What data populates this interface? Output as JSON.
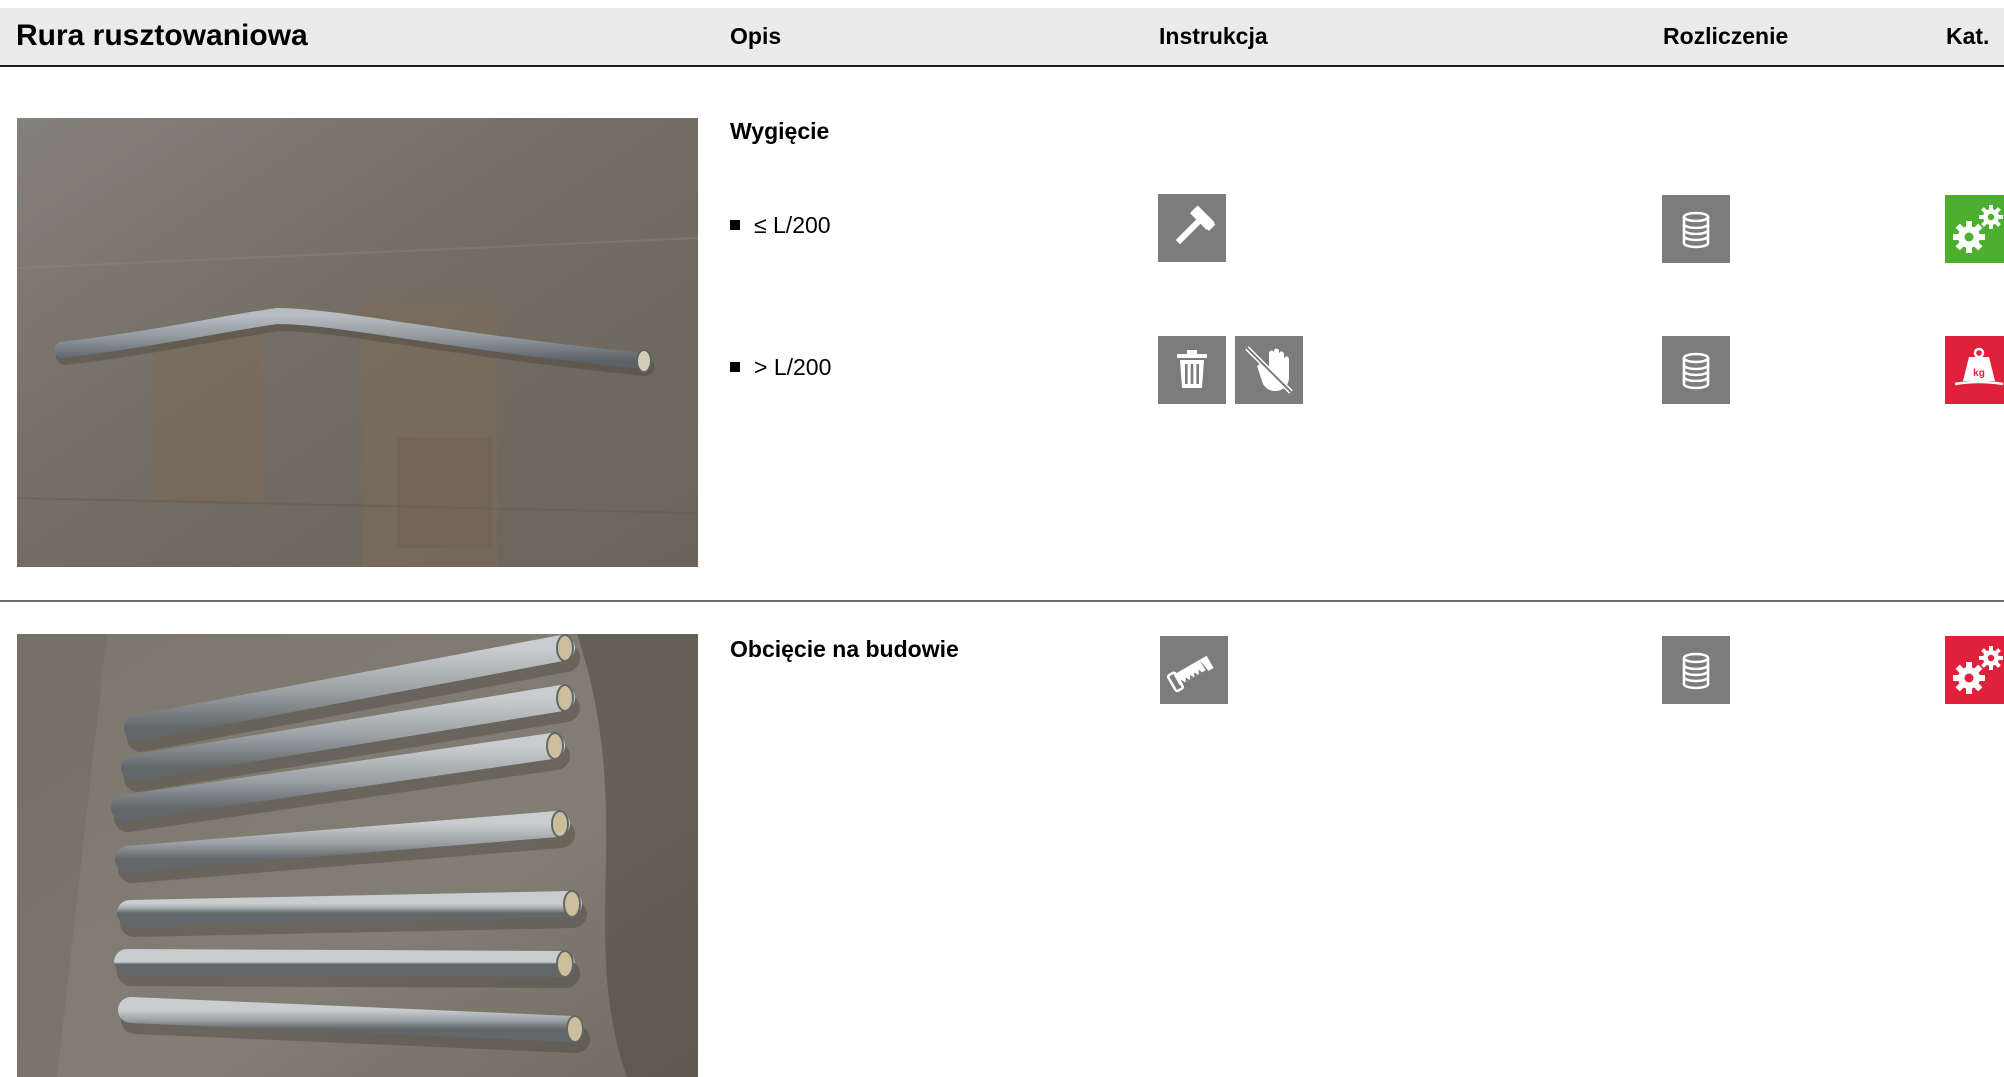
{
  "header": {
    "title": "Rura rusztowaniowa",
    "columns": {
      "opis": "Opis",
      "instrukcja": "Instrukcja",
      "rozliczenie": "Rozliczenie",
      "kat": "Kat."
    }
  },
  "sections": [
    {
      "heading": "Wygięcie",
      "rows": [
        {
          "text": "≤ L/200",
          "instruction_icons": [
            "hammer-icon"
          ],
          "billing_icon": "coin-stack-icon",
          "category_icon": "gears-icon",
          "category_color": "#4caf2f"
        },
        {
          "text": "> L/200",
          "instruction_icons": [
            "trash-icon",
            "no-touch-hand-icon"
          ],
          "billing_icon": "coin-stack-icon",
          "category_icon": "weight-kg-icon",
          "category_color": "#e0213b"
        }
      ]
    },
    {
      "heading": "Obcięcie na budowie",
      "rows": [
        {
          "text": "",
          "instruction_icons": [
            "saw-icon"
          ],
          "billing_icon": "coin-stack-icon",
          "category_icon": "gears-icon",
          "category_color": "#e0213b"
        }
      ]
    }
  ],
  "colors": {
    "icon_gray": "#7c7c7c",
    "green": "#4caf2f",
    "red": "#e0213b",
    "header_bg": "#ebebeb"
  }
}
